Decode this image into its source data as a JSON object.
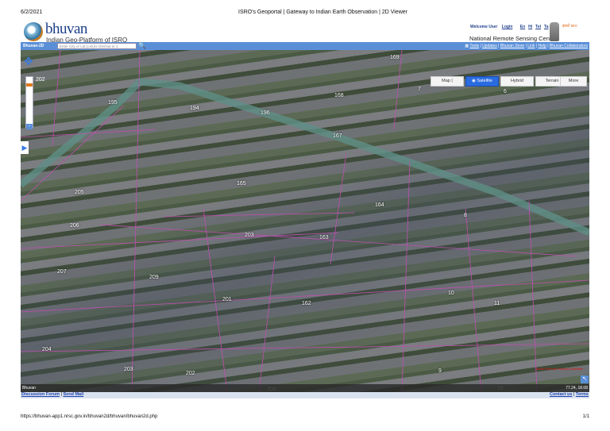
{
  "print_header": {
    "date": "6/2/2021",
    "title": "ISRO's Geoportal | Gateway to Indian Earth Observation | 2D Viewer"
  },
  "branding": {
    "name": "bhuvan",
    "tagline": "Indian Geo-Platform of ISRO",
    "org": "National Remote Sensing Centre",
    "isro_label": "इसरो isro"
  },
  "user_links": {
    "welcome": "Welcome User",
    "login": "Login",
    "langs": [
      "En",
      "Hi",
      "Tel",
      "Ta"
    ]
  },
  "toolbar": {
    "mode": "Bhuvan-2D",
    "search_placeholder": "Enter City or Lat,Lon(ex:chennai or 1",
    "links": [
      "Tools",
      "Updates",
      "Bhuvan Store",
      "Link",
      "Help",
      "Bhuvan Collaborators"
    ]
  },
  "map": {
    "map_types": [
      {
        "label": "Map |",
        "selected": false
      },
      {
        "label": "Satellite",
        "selected": true
      },
      {
        "label": "Hybrid",
        "selected": false
      },
      {
        "label": "Terrain",
        "selected": false
      },
      {
        "label": "More",
        "selected": false
      }
    ],
    "zoom_label": "202",
    "parcels": [
      "169",
      "7",
      "6",
      "195",
      "194",
      "168",
      "196",
      "167",
      "165",
      "164",
      "8",
      "205",
      "206",
      "203",
      "163",
      "207",
      "209",
      "201",
      "162",
      "10",
      "11",
      "204",
      "203",
      "202",
      "9",
      "200",
      "16"
    ],
    "attribution": "Indian Remote Sensing Satellites",
    "status_left": "Bhuvan",
    "coords": "77.24, 18.08"
  },
  "footer": {
    "left": [
      "Discussion Forum",
      "Send Mail"
    ],
    "right": [
      "Contact us",
      "Terms"
    ]
  },
  "print_footer": {
    "url": "https://bhuvan-app1.nrsc.gov.in/bhuvan2d/bhuvan/bhuvan2d.php",
    "page": "1/1"
  }
}
